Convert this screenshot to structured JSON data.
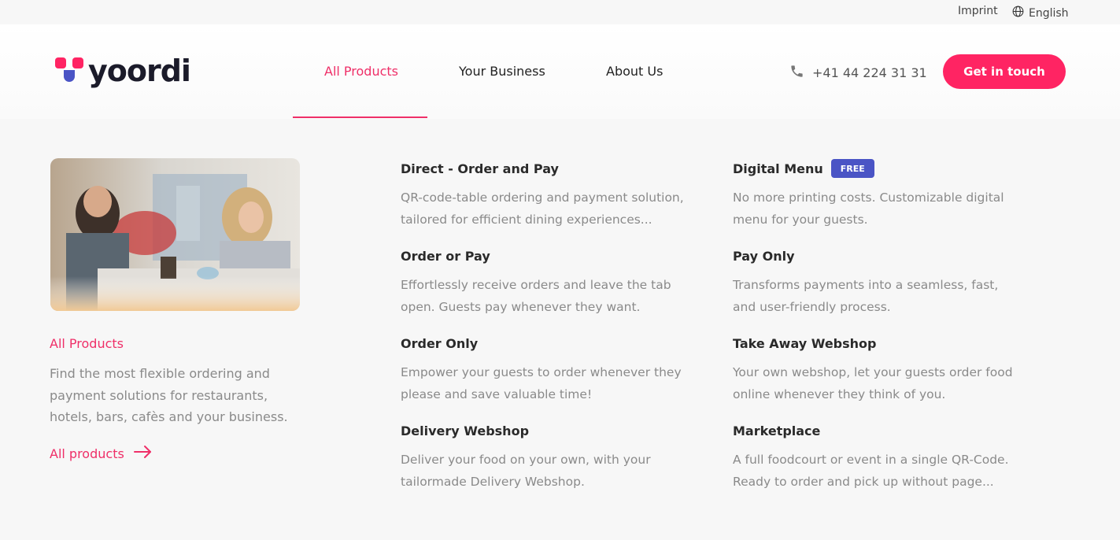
{
  "topbar": {
    "imprint": "Imprint",
    "language": "English"
  },
  "brand": {
    "name": "yoordi",
    "accent": "#ef2f68",
    "logo_pink": "#ff2463",
    "logo_blue": "#4a54c5"
  },
  "nav": {
    "items": [
      {
        "label": "All Products",
        "active": true
      },
      {
        "label": "Your Business",
        "active": false
      },
      {
        "label": "About Us",
        "active": false
      }
    ]
  },
  "contact": {
    "phone": "+41 44 224 31 31",
    "cta": "Get in touch"
  },
  "intro": {
    "title": "All Products",
    "description": "Find the most flexible ordering and payment solutions for restaurants, hotels, bars, cafès and your business.",
    "link": "All products"
  },
  "products": [
    {
      "title": "Direct - Order and Pay",
      "description": "QR-code-table ordering and payment solution, tailored for efficient dining experiences..."
    },
    {
      "title": "Order or Pay",
      "description": "Effortlessly receive orders and leave the tab open. Guests pay whenever they want."
    },
    {
      "title": "Order Only",
      "description": "Empower your guests to order whenever they please and save valuable time!"
    },
    {
      "title": "Delivery Webshop",
      "description": "Deliver your food on your own, with your tailormade Delivery Webshop."
    },
    {
      "title": "Digital Menu",
      "badge": "FREE",
      "description": "No more printing costs. Customizable digital menu for your guests."
    },
    {
      "title": "Pay Only",
      "description": "Transforms payments into a seamless, fast, and user-friendly process."
    },
    {
      "title": "Take Away Webshop",
      "description": "Your own webshop, let your guests order food online whenever they think of you."
    },
    {
      "title": "Marketplace",
      "description": "A full foodcourt or event in a single QR-Code. Ready to order and pick up without page..."
    }
  ]
}
